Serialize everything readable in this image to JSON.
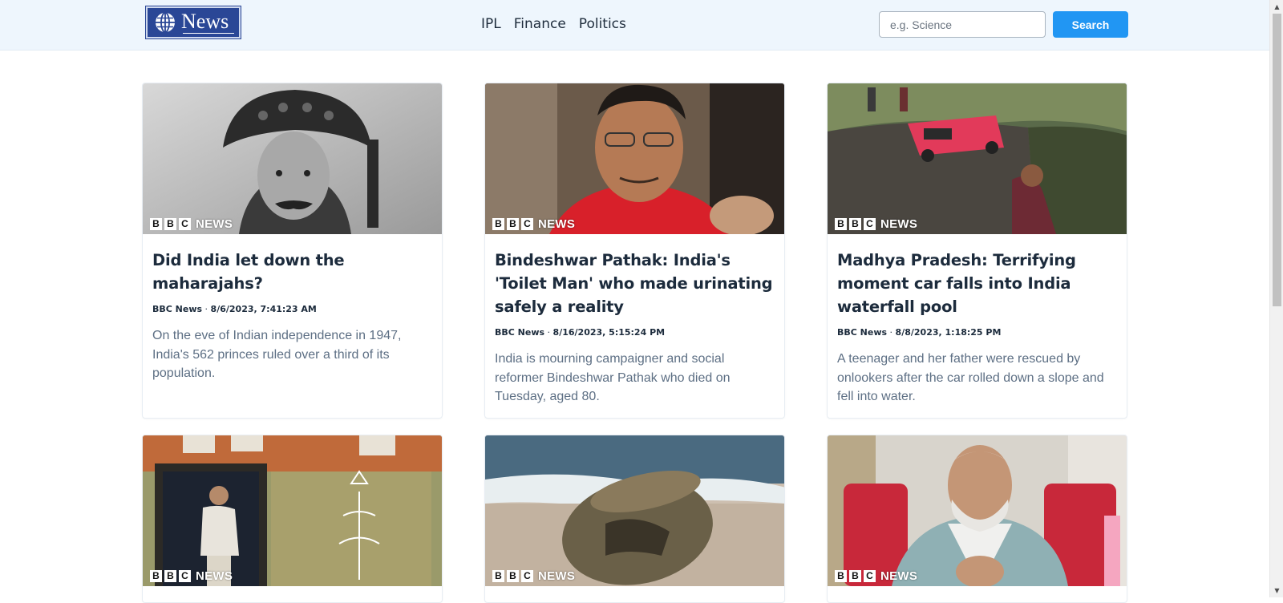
{
  "navbar": {
    "logo_text": "News",
    "links": [
      "IPL",
      "Finance",
      "Politics"
    ],
    "search_placeholder": "e.g. Science",
    "search_label": "Search"
  },
  "badge": {
    "letters": [
      "B",
      "B",
      "C"
    ],
    "word": "NEWS"
  },
  "cards": [
    {
      "title": "Did India let down the maharajahs?",
      "source": "BBC News",
      "date": "8/6/2023, 7:41:23 AM",
      "description": "On the eve of Indian independence in 1947, India's 562 princes ruled over a third of its population."
    },
    {
      "title": "Bindeshwar Pathak: India's 'Toilet Man' who made urinating safely a reality",
      "source": "BBC News",
      "date": "8/16/2023, 5:15:24 PM",
      "description": "India is mourning campaigner and social reformer Bindeshwar Pathak who died on Tuesday, aged 80."
    },
    {
      "title": "Madhya Pradesh: Terrifying moment car falls into India waterfall pool",
      "source": "BBC News",
      "date": "8/8/2023, 1:18:25 PM",
      "description": "A teenager and her father were rescued by onlookers after the car rolled down a slope and fell into water."
    },
    {
      "title": "",
      "source": "",
      "date": "",
      "description": ""
    },
    {
      "title": "",
      "source": "",
      "date": "",
      "description": ""
    },
    {
      "title": "",
      "source": "",
      "date": "",
      "description": ""
    }
  ],
  "colors": {
    "navbar_bg": "#eef6fd",
    "accent": "#2196f3",
    "logo_bg": "#2a4796",
    "title": "#1c2b3c",
    "description": "#5d6f84"
  }
}
